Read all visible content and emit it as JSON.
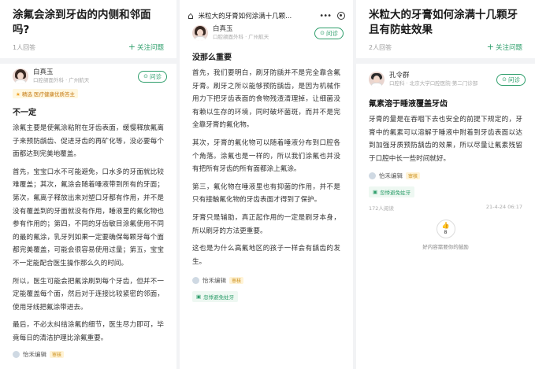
{
  "panel1": {
    "question_title": "涂氟会涂到牙齿的内侧和邻面吗?",
    "answer_count": "1人回答",
    "follow_label": "关注问题",
    "doctor": {
      "name": "白真玉",
      "dept": "口腔颌面外科 · 广州航天"
    },
    "ask_label": "问诊",
    "badge": "精选 医疗健康优质答主",
    "answer_head": "不一定",
    "paragraphs": [
      "涂氟主要是使氟涂粘附在牙齿表面，缓慢释放氟离子来预防龋齿、促进牙齿的再矿化等，没必要每个面都达到完美地覆盖。",
      "首先，宝宝口水不可能避免，口水多的牙面就比较难覆盖；其次，氟涂会随着唾液带到所有的牙面；第次，氟离子释放出来对塑口牙都有作用，并不是没有覆盖到的牙面就没有作用，睡液里的氟化物也参有作用的；第四，不同的牙齿敏目涂氟使用不同的最的氟涂，乳牙列如果一定要确保每颗牙每个面都完美覆盖，可能会很容易使用过量；第五，宝宝不一定能配合医生操作那么久的时间。",
      "所以，医生可能会把氟涂刷到每个牙齿，但并不一定能覆盖每个面，然后对于连接比较紧密的邻面，使用牙线把氟涂带进去。",
      "最后，不必太纠结涂氟的细节，医生尽力即可，毕竟每日的清洁护理比涂氟重要。"
    ],
    "editor": "怡禾编辑",
    "editor_tag": "审核"
  },
  "panel2": {
    "topbar_title": "米粒大的牙膏如何涂满十几颗...",
    "doctor": {
      "name": "白真玉",
      "dept": "口腔颌面外科 · 广州航天"
    },
    "ask_label": "问诊",
    "answer_head": "没那么重要",
    "paragraphs": [
      "首先，我们要明白，刷牙防龋并不是完全靠含氟牙膏。刷牙之所以能够预防龋齿，是因为机械作用力下把牙齿表面的食物残渣清理掉，让细菌没有赖以生存的环境，同时破坏菌斑，而并不是完全靠牙膏的氟化物。",
      "其次，牙膏的氟化物可以随着唾液分布到口腔各个角落。涂氟也是一样的，所以我们涂氟也并没有把所有牙齿的所有面都涂上氟涂。",
      "第三，氟化物在唾液里也有抑菌的作用，并不是只有接触氟化物的牙齿表面才得到了保护。",
      "牙膏只是辅助，真正起作用的一定是刷牙本身，所以刷牙的方法更重要。",
      "这也是为什么高氟地区的孩子一样会有龋齿的发生。"
    ],
    "editor": "怡禾编辑",
    "editor_tag": "审核",
    "chip": "忽悸避免蛀牙"
  },
  "panel3": {
    "question_title": "米粒大的牙膏如何涂满十几颗牙且有防蛀效果",
    "answer_count": "2人回答",
    "follow_label": "关注问题",
    "doctor": {
      "name": "孔令群",
      "dept": "口腔科 · 北京大学口腔医院·第二门诊部"
    },
    "ask_label": "问诊",
    "answer_head": "氟素溶于睡液覆盖牙齿",
    "paragraphs": [
      "牙膏的量是在吞咽下去也安全的前提下规定的，牙膏中的氟素可以溶解于睡液中附着到牙齿表面以达到加强牙质预防龋齿的效果，所以尽量让氟素残留于口腔中长一些时间就好。"
    ],
    "editor": "怡禾编辑",
    "editor_tag": "审核",
    "chip": "忽悸避免蛀牙",
    "reads": "172人阅读",
    "date": "21-4-24 06:17",
    "like_count": "8",
    "like_text": "好内容需要你的鼓励"
  }
}
